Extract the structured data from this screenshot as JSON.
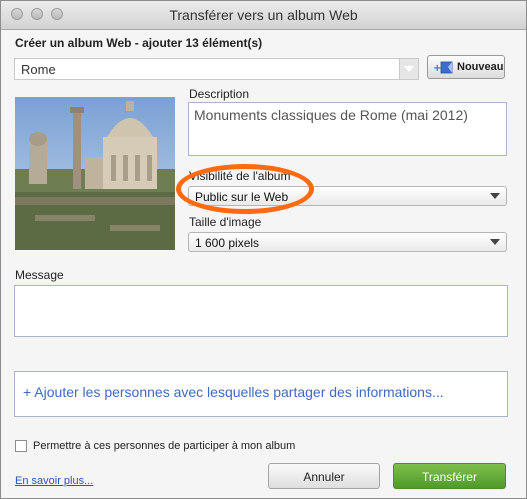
{
  "window": {
    "title": "Transférer vers un album Web"
  },
  "album": {
    "heading": "Créer un album Web - ajouter 13 élément(s)",
    "name_value": "Rome",
    "new_button_label": "Nouveau"
  },
  "description": {
    "label": "Description",
    "value": "Monuments classiques de Rome (mai 2012)"
  },
  "visibility": {
    "label": "Visibilité de l'album",
    "selected": "Public sur le Web"
  },
  "image_size": {
    "label": "Taille d'image",
    "selected": "1 600 pixels"
  },
  "message": {
    "label": "Message",
    "value": ""
  },
  "share": {
    "placeholder": "+ Ajouter les personnes avec lesquelles partager des informations..."
  },
  "participate": {
    "label": "Permettre à ces personnes de participer à mon album",
    "checked": false
  },
  "footer": {
    "learn_more": "En savoir plus...",
    "cancel_label": "Annuler",
    "submit_label": "Transférer"
  },
  "colors": {
    "highlight_ring": "#ff6a10",
    "submit_button": "#5da132",
    "link": "#3a6bc6"
  }
}
